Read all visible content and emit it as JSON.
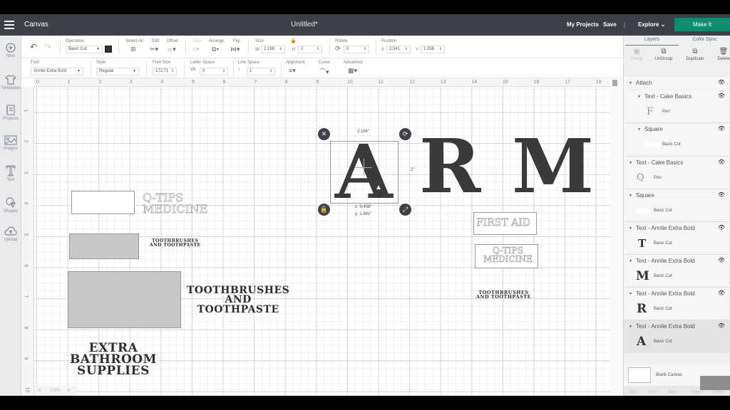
{
  "topbar": {
    "app_name": "Canvas",
    "doc_title": "Untitled*",
    "my_projects": "My Projects",
    "save": "Save",
    "separator": "|",
    "explore": "Explore",
    "make_it": "Make It",
    "make_it_color": "#0a8e6d"
  },
  "sidebar": {
    "items": [
      {
        "label": "New",
        "icon": "plus-circle-icon"
      },
      {
        "label": "Templates",
        "icon": "tshirt-icon"
      },
      {
        "label": "Projects",
        "icon": "notebook-icon"
      },
      {
        "label": "Images",
        "icon": "image-icon"
      },
      {
        "label": "Text",
        "icon": "text-t-icon"
      },
      {
        "label": "Shapes",
        "icon": "shapes-icon"
      },
      {
        "label": "Upload",
        "icon": "cloud-upload-icon"
      }
    ]
  },
  "toolbar": {
    "operation_label": "Operation",
    "operation_value": "Basic Cut",
    "select_all": "Select All",
    "edit": "Edit",
    "offset": "Offset",
    "align": "Align",
    "arrange": "Arrange",
    "flip": "Flip",
    "size_label": "Size",
    "w_label": "W",
    "w_value": "2.186",
    "h_label": "H",
    "h_value": "2",
    "rotate_label": "Rotate",
    "rotate_value": "0",
    "position_label": "Position",
    "x_label": "X",
    "x_value": "2.541",
    "y_label": "Y",
    "y_value": "1.256",
    "font_label": "Font",
    "font_value": "Annlie Extra Bold",
    "style_label": "Style",
    "style_value": "Regular",
    "font_size_label": "Font Size",
    "font_size_value": "172.71",
    "letter_space_label": "Letter Space",
    "letter_space_value": "0",
    "line_space_label": "Line Space",
    "line_space_value": "1",
    "alignment_label": "Alignment",
    "curve_label": "Curve",
    "advanced_label": "Advanced"
  },
  "canvas": {
    "ruler_top": [
      "0",
      "1",
      "2",
      "3",
      "4",
      "5",
      "6",
      "7",
      "8",
      "9",
      "10",
      "11",
      "12",
      "13",
      "14",
      "15",
      "16",
      "17",
      "18"
    ],
    "ruler_left": [
      "1",
      "2",
      "3",
      "4",
      "5",
      "6",
      "7",
      "8",
      "9",
      "10"
    ],
    "objects": {
      "qtips_left_line1": "Q-TIPS",
      "qtips_left_line2": "MEDICINE",
      "tooth_small_left_line1": "TOOTHBRUSHES",
      "tooth_small_left_line2": "AND TOOTHPASTE",
      "tooth_big_line1": "TOOTHBRUSHES",
      "tooth_big_line2": "AND",
      "tooth_big_line3": "TOOTHPASTE",
      "extra_line1": "EXTRA",
      "extra_line2": "BATHROOM",
      "extra_line3": "SUPPLIES",
      "letter_a": "A",
      "letter_r": "R",
      "letter_m": "M",
      "first_aid": "FIRST AID",
      "qtips_right_line1": "Q-TIPS",
      "qtips_right_line2": "MEDICINE",
      "tooth_right_line1": "TOOTHBRUSHES",
      "tooth_right_line2": "AND TOOTHPASTE"
    },
    "selection": {
      "width_readout": "2.186\"",
      "height_readout": "2\"",
      "x_readout": "x: 9.458\"",
      "y_readout": "y: 1.881\""
    },
    "zoom_level": "100%"
  },
  "right_panel": {
    "tabs": [
      "Layers",
      "Color Sync"
    ],
    "actions": [
      "Group",
      "UnGroup",
      "Duplicate",
      "Delete"
    ],
    "layers": [
      {
        "title": "Attach",
        "level": 0
      },
      {
        "title": "Text - Cake Basics",
        "level": 1,
        "sub": "Pen",
        "thumb": "F"
      },
      {
        "title": "Square",
        "level": 1,
        "sub": "Basic Cut",
        "thumb": "white-rect"
      },
      {
        "title": "Text - Cake Basics",
        "level": 0,
        "sub": "Pen",
        "thumb": "Q"
      },
      {
        "title": "Square",
        "level": 0,
        "sub": "Basic Cut",
        "thumb": "white-rect"
      },
      {
        "title": "Text - Annlie Extra Bold",
        "level": 0,
        "sub": "Basic Cut",
        "thumb": "T"
      },
      {
        "title": "Text - Annlie Extra Bold",
        "level": 0,
        "sub": "Basic Cut",
        "thumb": "M"
      },
      {
        "title": "Text - Annlie Extra Bold",
        "level": 0,
        "sub": "Basic Cut",
        "thumb": "R"
      },
      {
        "title": "Text - Annlie Extra Bold",
        "level": 0,
        "sub": "Basic Cut",
        "thumb": "A",
        "selected": true
      }
    ],
    "blank_canvas": "Blank Canvas",
    "bottom_actions": [
      "Slice",
      "Weld",
      "Attach",
      "Flatten",
      "Contour"
    ]
  }
}
